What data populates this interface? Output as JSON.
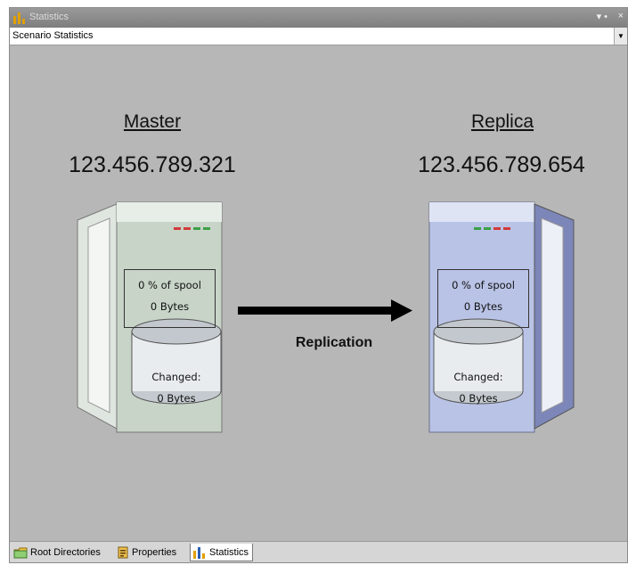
{
  "window": {
    "title": "Statistics",
    "pin_glyph": "− q",
    "close_glyph": "×"
  },
  "selector": {
    "value": "Scenario Statistics",
    "arrow_icon": "chevron-down-icon"
  },
  "master": {
    "name": "Master",
    "ip": "123.456.789.321",
    "spool_percent": "0 % of spool",
    "spool_bytes": "0 Bytes",
    "changed_label": "Changed:",
    "changed_bytes": "0 Bytes",
    "color": "#c8d4c8"
  },
  "replica": {
    "name": "Replica",
    "ip": "123.456.789.654",
    "spool_percent": "0 % of spool",
    "spool_bytes": "0 Bytes",
    "changed_label": "Changed:",
    "changed_bytes": "0 Bytes",
    "color": "#b9c3e6"
  },
  "replication": {
    "label": "Replication"
  },
  "tabs": [
    {
      "label": "Root Directories",
      "icon": "folder-icon"
    },
    {
      "label": "Properties",
      "icon": "properties-icon"
    },
    {
      "label": "Statistics",
      "icon": "bar-chart-icon",
      "active": true
    }
  ],
  "colors": {
    "canvas": "#b7b7b7",
    "titlebar": "#8a8a8a",
    "led_red": "#d23a3a",
    "led_green": "#3aa046"
  }
}
